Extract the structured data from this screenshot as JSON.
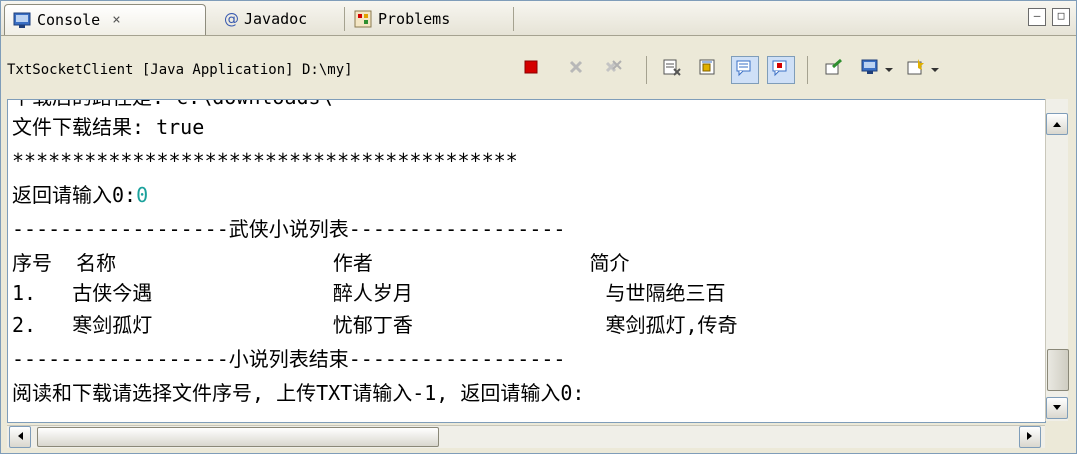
{
  "tabs": [
    {
      "label": "Console",
      "close": "×"
    },
    {
      "label": "Javadoc"
    },
    {
      "label": "Problems"
    }
  ],
  "toolbar": {
    "process_label": "TxtSocketClient [Java Application] D:\\my]"
  },
  "console": {
    "partial_top": "下载后的路径是: c:\\downloads\\",
    "lines": [
      "文件下载结果: true",
      "******************************************",
      "返回请输入0:",
      "------------------武侠小说列表------------------",
      "序号  名称                  作者                  简介",
      "1.   古侠今遇               醉人岁月                与世隔绝三百",
      "2.   寒剑孤灯               忧郁丁香                寒剑孤灯,传奇",
      "------------------小说列表结束------------------",
      "阅读和下载请选择文件序号, 上传TXT请输入-1, 返回请输入0:"
    ],
    "user_input": "0"
  },
  "colors": {
    "input_text": "#1aa19c",
    "terminate_red": "#d40000"
  }
}
